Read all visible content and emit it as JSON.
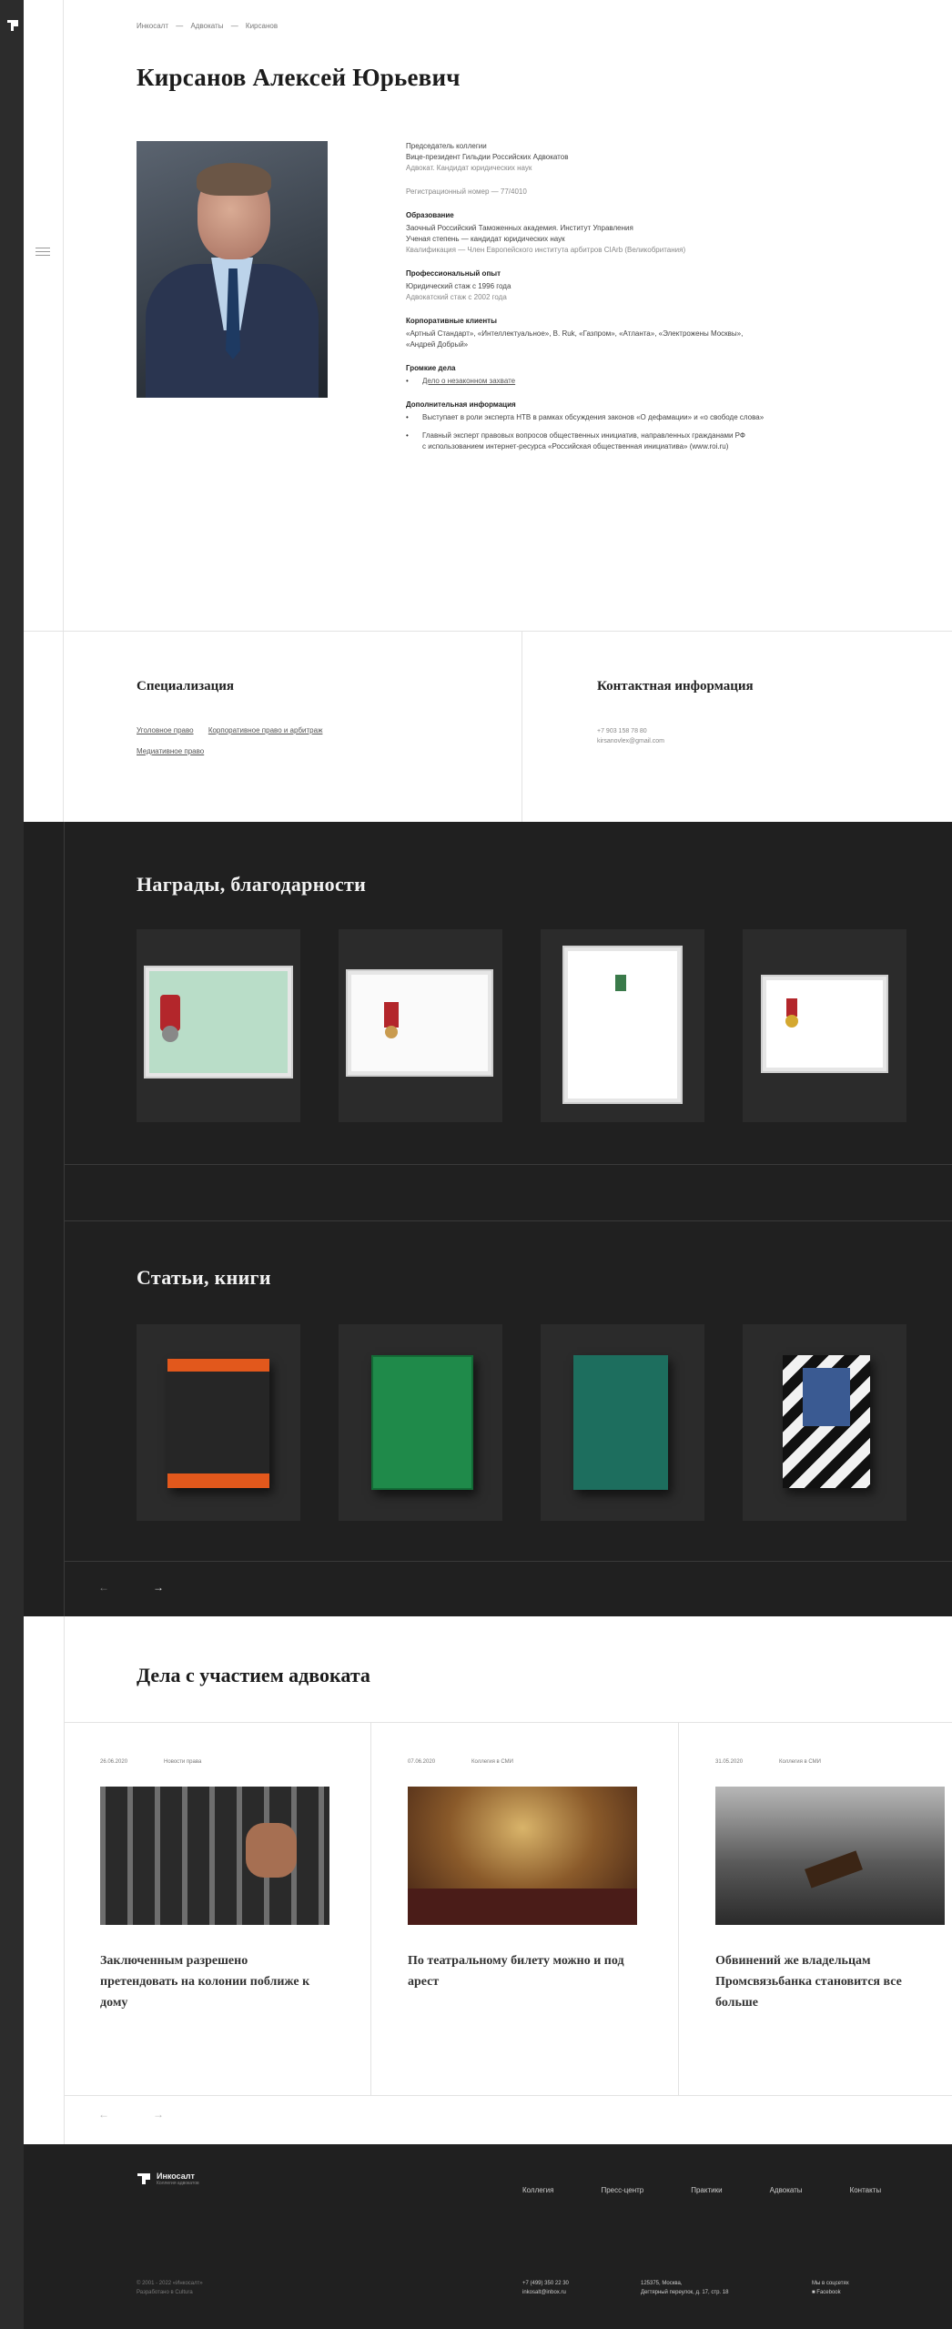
{
  "crumbs": [
    "Инкосалт",
    "Адвокаты",
    "Кирсанов"
  ],
  "profile": {
    "name": "Кирсанов Алексей Юрьевич",
    "info": {
      "role1": "Председатель коллегии",
      "role2": "Вице-президент Гильдии Российских Адвокатов",
      "role3": "Адвокат. Кандидат юридических наук",
      "reg": "Регистрационный номер — 77/4010",
      "edu_h": "Образование",
      "edu1": "Заочный Российский Таможенных академия. Институт Управления",
      "edu2": "Ученая степень — кандидат юридических наук",
      "edu3": "Квалификация — Член Европейского института арбитров CIArb (Великобритания)",
      "exp_h": "Профессиональный опыт",
      "exp1": "Юридический стаж с 1996 года",
      "exp2": "Адвокатский стаж с 2002 года",
      "corp_h": "Корпоративные клиенты",
      "corp1": "«Артный Стандарт», «Интеллектуальное», В. Ruk, «Газпром», «Атланта», «Электрожены Москвы»,",
      "corp2": "«Андрей Добрый»",
      "cases_h": "Громкие дела",
      "case_link": "Дело о незаконном захвате",
      "add_h": "Дополнительная информация",
      "add1": "Выступает в роли эксперта НТВ в рамках обсуждения законов «О дефамации» и «о свободе слова»",
      "add2": "Главный эксперт правовых вопросов общественных инициатив, направленных гражданами РФ",
      "add3": "с использованием интернет-ресурса «Российская общественная инициатива» (www.roi.ru)"
    }
  },
  "specialization": {
    "title": "Специализация",
    "links": [
      "Уголовное право",
      "Корпоративное право и арбитраж",
      "Медиативное право"
    ]
  },
  "contacts": {
    "title": "Контактная информация",
    "phone": "+7 903 158 78 80",
    "email": "kirsanovlex@gmail.com"
  },
  "awards": {
    "title": "Награды, благодарности"
  },
  "articles": {
    "title": "Статьи, книги",
    "prev": "←",
    "next": "→"
  },
  "cases": {
    "title": "Дела с участием адвоката",
    "items": [
      {
        "date": "26.06.2020",
        "tag": "Новости права",
        "title": "Заключенным разрешено претендовать на колонии поближе к дому"
      },
      {
        "date": "07.06.2020",
        "tag": "Коллегия в СМИ",
        "title": "По театральному билету можно и под арест"
      },
      {
        "date": "31.05.2020",
        "tag": "Коллегия в СМИ",
        "title": "Обвинений же владельцам Промсвязьбанка становится все больше"
      }
    ],
    "prev": "←",
    "next": "→"
  },
  "footer": {
    "brand": "Инкосалт",
    "brand_sub": "Коллегия адвокатов",
    "nav": [
      "Коллегия",
      "Пресс-центр",
      "Практики",
      "Адвокаты",
      "Контакты"
    ],
    "copy1": "© 2001 - 2022 «Инкосалт»",
    "copy2": "Разработано в Cultura",
    "phone": "+7 (499) 350 22 30",
    "email": "inkosalt@inbox.ru",
    "addr1": "125375, Москва,",
    "addr2": "Дегтярный переулок, д. 17, стр. 18",
    "social_h": "Мы в соцсетях",
    "social": "Facebook"
  }
}
